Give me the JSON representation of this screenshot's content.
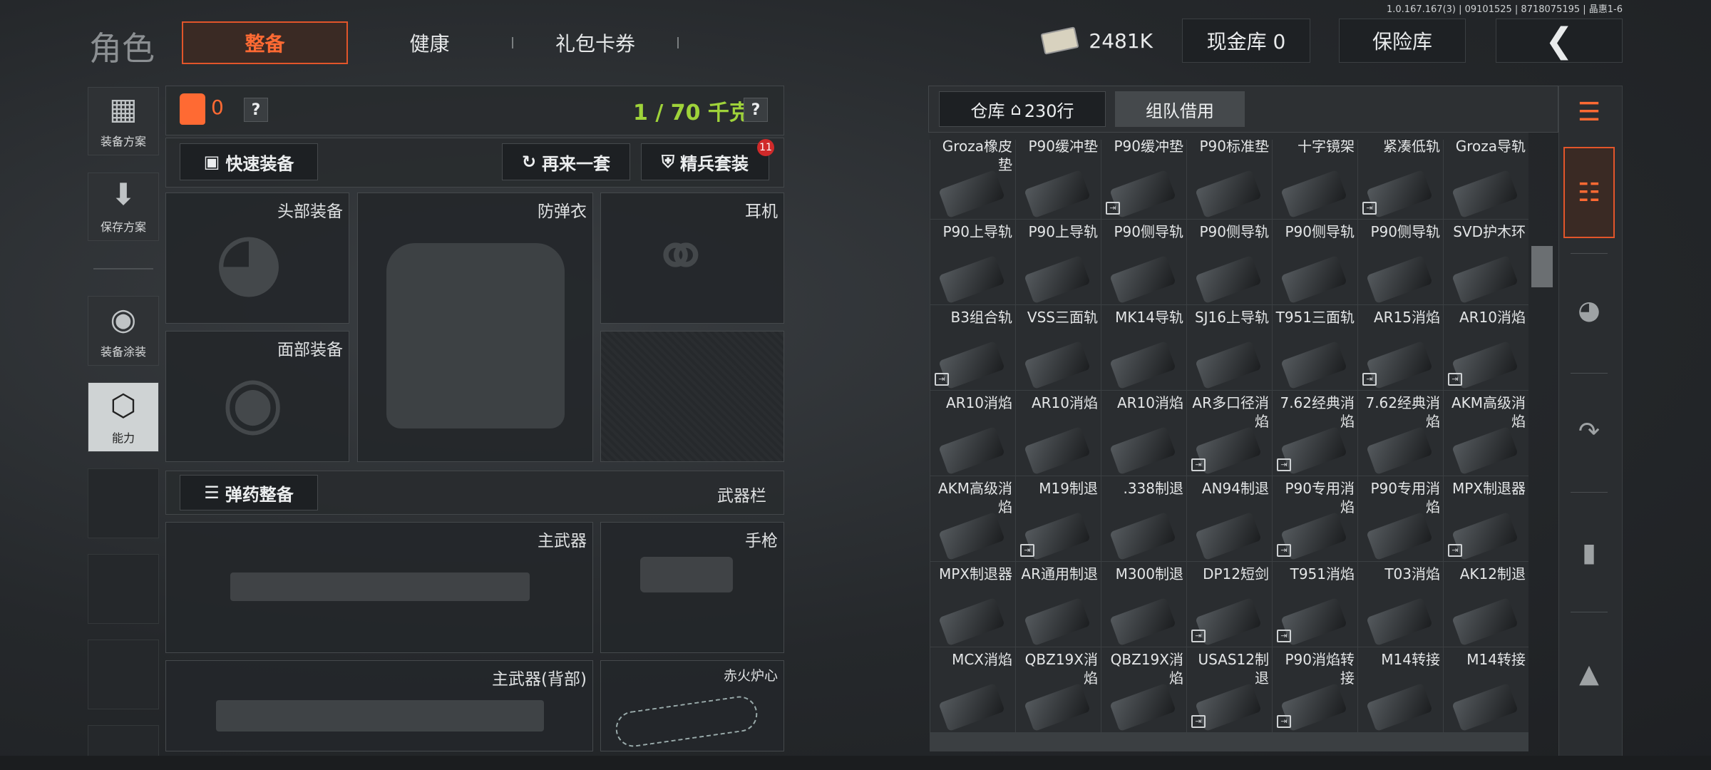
{
  "version": "1.0.167.167(3) | 09101525 | 8718075195 | 晶惠1-6",
  "title": "角色",
  "tabs": [
    {
      "label": "整备",
      "active": true
    },
    {
      "label": "健康"
    },
    {
      "label": "礼包卡券"
    }
  ],
  "topbar": {
    "money": "2481K",
    "cash_vault": "现金库 0",
    "insurance": "保险库"
  },
  "left_nav": [
    {
      "label": "装备方案",
      "icon": "vest-icon"
    },
    {
      "label": "保存方案",
      "icon": "download-icon"
    },
    {
      "label": "装备涂装",
      "icon": "helmet-paint-icon"
    },
    {
      "label": "能力",
      "icon": "ability-icon"
    }
  ],
  "loadout": {
    "armor_count": "0",
    "weight": "1 / 70 千克",
    "help": "?",
    "quick_equip": "快速装备",
    "again": "再来一套",
    "elite": "精兵套装",
    "elite_badge": "11",
    "slots": {
      "head": "头部装备",
      "vest": "防弹衣",
      "ear": "耳机",
      "face": "面部装备"
    },
    "ammo_btn": "弹药整备",
    "weapon_bar": "武器栏",
    "weapon_slots": {
      "primary": "主武器",
      "pistol": "手枪",
      "primary_back": "主武器(背部)",
      "melee": "赤火炉心"
    }
  },
  "warehouse": {
    "tab_label": "仓库",
    "rows": "230行",
    "team_borrow": "组队借用"
  },
  "items": [
    {
      "name": "Groza橡皮垫",
      "mark": false
    },
    {
      "name": "P90缓冲垫",
      "mark": false
    },
    {
      "name": "P90缓冲垫",
      "mark": true
    },
    {
      "name": "P90标准垫",
      "mark": false
    },
    {
      "name": "十字镜架",
      "mark": false
    },
    {
      "name": "紧凑低轨",
      "mark": true
    },
    {
      "name": "Groza导轨",
      "mark": false
    },
    {
      "name": "P90上导轨",
      "mark": false
    },
    {
      "name": "P90上导轨",
      "mark": false
    },
    {
      "name": "P90侧导轨",
      "mark": false
    },
    {
      "name": "P90侧导轨",
      "mark": false
    },
    {
      "name": "P90侧导轨",
      "mark": false
    },
    {
      "name": "P90侧导轨",
      "mark": false
    },
    {
      "name": "SVD护木环",
      "mark": false
    },
    {
      "name": "B3组合轨",
      "mark": true
    },
    {
      "name": "VSS三面轨",
      "mark": false
    },
    {
      "name": "MK14导轨",
      "mark": false
    },
    {
      "name": "SJ16上导轨",
      "mark": false
    },
    {
      "name": "T951三面轨",
      "mark": false
    },
    {
      "name": "AR15消焰",
      "mark": true
    },
    {
      "name": "AR10消焰",
      "mark": true
    },
    {
      "name": "AR10消焰",
      "mark": false
    },
    {
      "name": "AR10消焰",
      "mark": false
    },
    {
      "name": "AR10消焰",
      "mark": false
    },
    {
      "name": "AR多口径消焰",
      "mark": true
    },
    {
      "name": "7.62经典消焰",
      "mark": true
    },
    {
      "name": "7.62经典消焰",
      "mark": false
    },
    {
      "name": "AKM高级消焰",
      "mark": false
    },
    {
      "name": "AKM高级消焰",
      "mark": false
    },
    {
      "name": "M19制退",
      "mark": true
    },
    {
      "name": ".338制退",
      "mark": false
    },
    {
      "name": "AN94制退",
      "mark": false
    },
    {
      "name": "P90专用消焰",
      "mark": true
    },
    {
      "name": "P90专用消焰",
      "mark": false
    },
    {
      "name": "MPX制退器",
      "mark": true
    },
    {
      "name": "MPX制退器",
      "mark": false
    },
    {
      "name": "AR通用制退",
      "mark": false
    },
    {
      "name": "M300制退",
      "mark": false
    },
    {
      "name": "DP12短剑",
      "mark": true
    },
    {
      "name": "T951消焰",
      "mark": true
    },
    {
      "name": "T03消焰",
      "mark": false
    },
    {
      "name": "AK12制退",
      "mark": false
    },
    {
      "name": "MCX消焰",
      "mark": false
    },
    {
      "name": "QBZ19X消焰",
      "mark": false
    },
    {
      "name": "QBZ19X消焰",
      "mark": false
    },
    {
      "name": "USAS12制退",
      "mark": true
    },
    {
      "name": "P90消焰转接",
      "mark": true
    },
    {
      "name": "M14转接",
      "mark": false
    },
    {
      "name": "M14转接",
      "mark": false
    }
  ],
  "right_nav": [
    "layers-refresh-icon",
    "layers-download-icon",
    "helmet-icon",
    "rifle-icon",
    "magazine-icon",
    "ammo-icon"
  ],
  "colors": {
    "accent": "#ff6a33",
    "weight": "#9fd33a",
    "badge": "#d02a2a"
  }
}
